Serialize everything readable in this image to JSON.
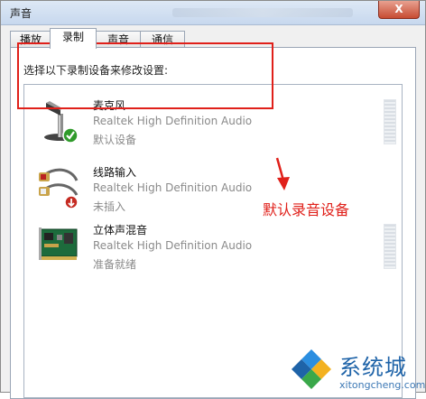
{
  "window": {
    "title": "声音",
    "close_symbol": "X"
  },
  "tabs": [
    {
      "label": "播放",
      "active": false
    },
    {
      "label": "录制",
      "active": true
    },
    {
      "label": "声音",
      "active": false
    },
    {
      "label": "通信",
      "active": false
    }
  ],
  "instruction": "选择以下录制设备来修改设置:",
  "devices": [
    {
      "name": "麦克风",
      "driver": "Realtek High Definition Audio",
      "status": "默认设备",
      "icon": "microphone-icon",
      "badge": "default-check-icon"
    },
    {
      "name": "线路输入",
      "driver": "Realtek High Definition Audio",
      "status": "未插入",
      "icon": "line-in-icon",
      "badge": "unplugged-icon"
    },
    {
      "name": "立体声混音",
      "driver": "Realtek High Definition Audio",
      "status": "准备就绪",
      "icon": "sound-card-icon",
      "badge": null
    }
  ],
  "annotation": {
    "text": "默认录音设备",
    "color": "#e0201a"
  },
  "watermark": {
    "brand": "系统城",
    "url": "xitongcheng.com"
  }
}
